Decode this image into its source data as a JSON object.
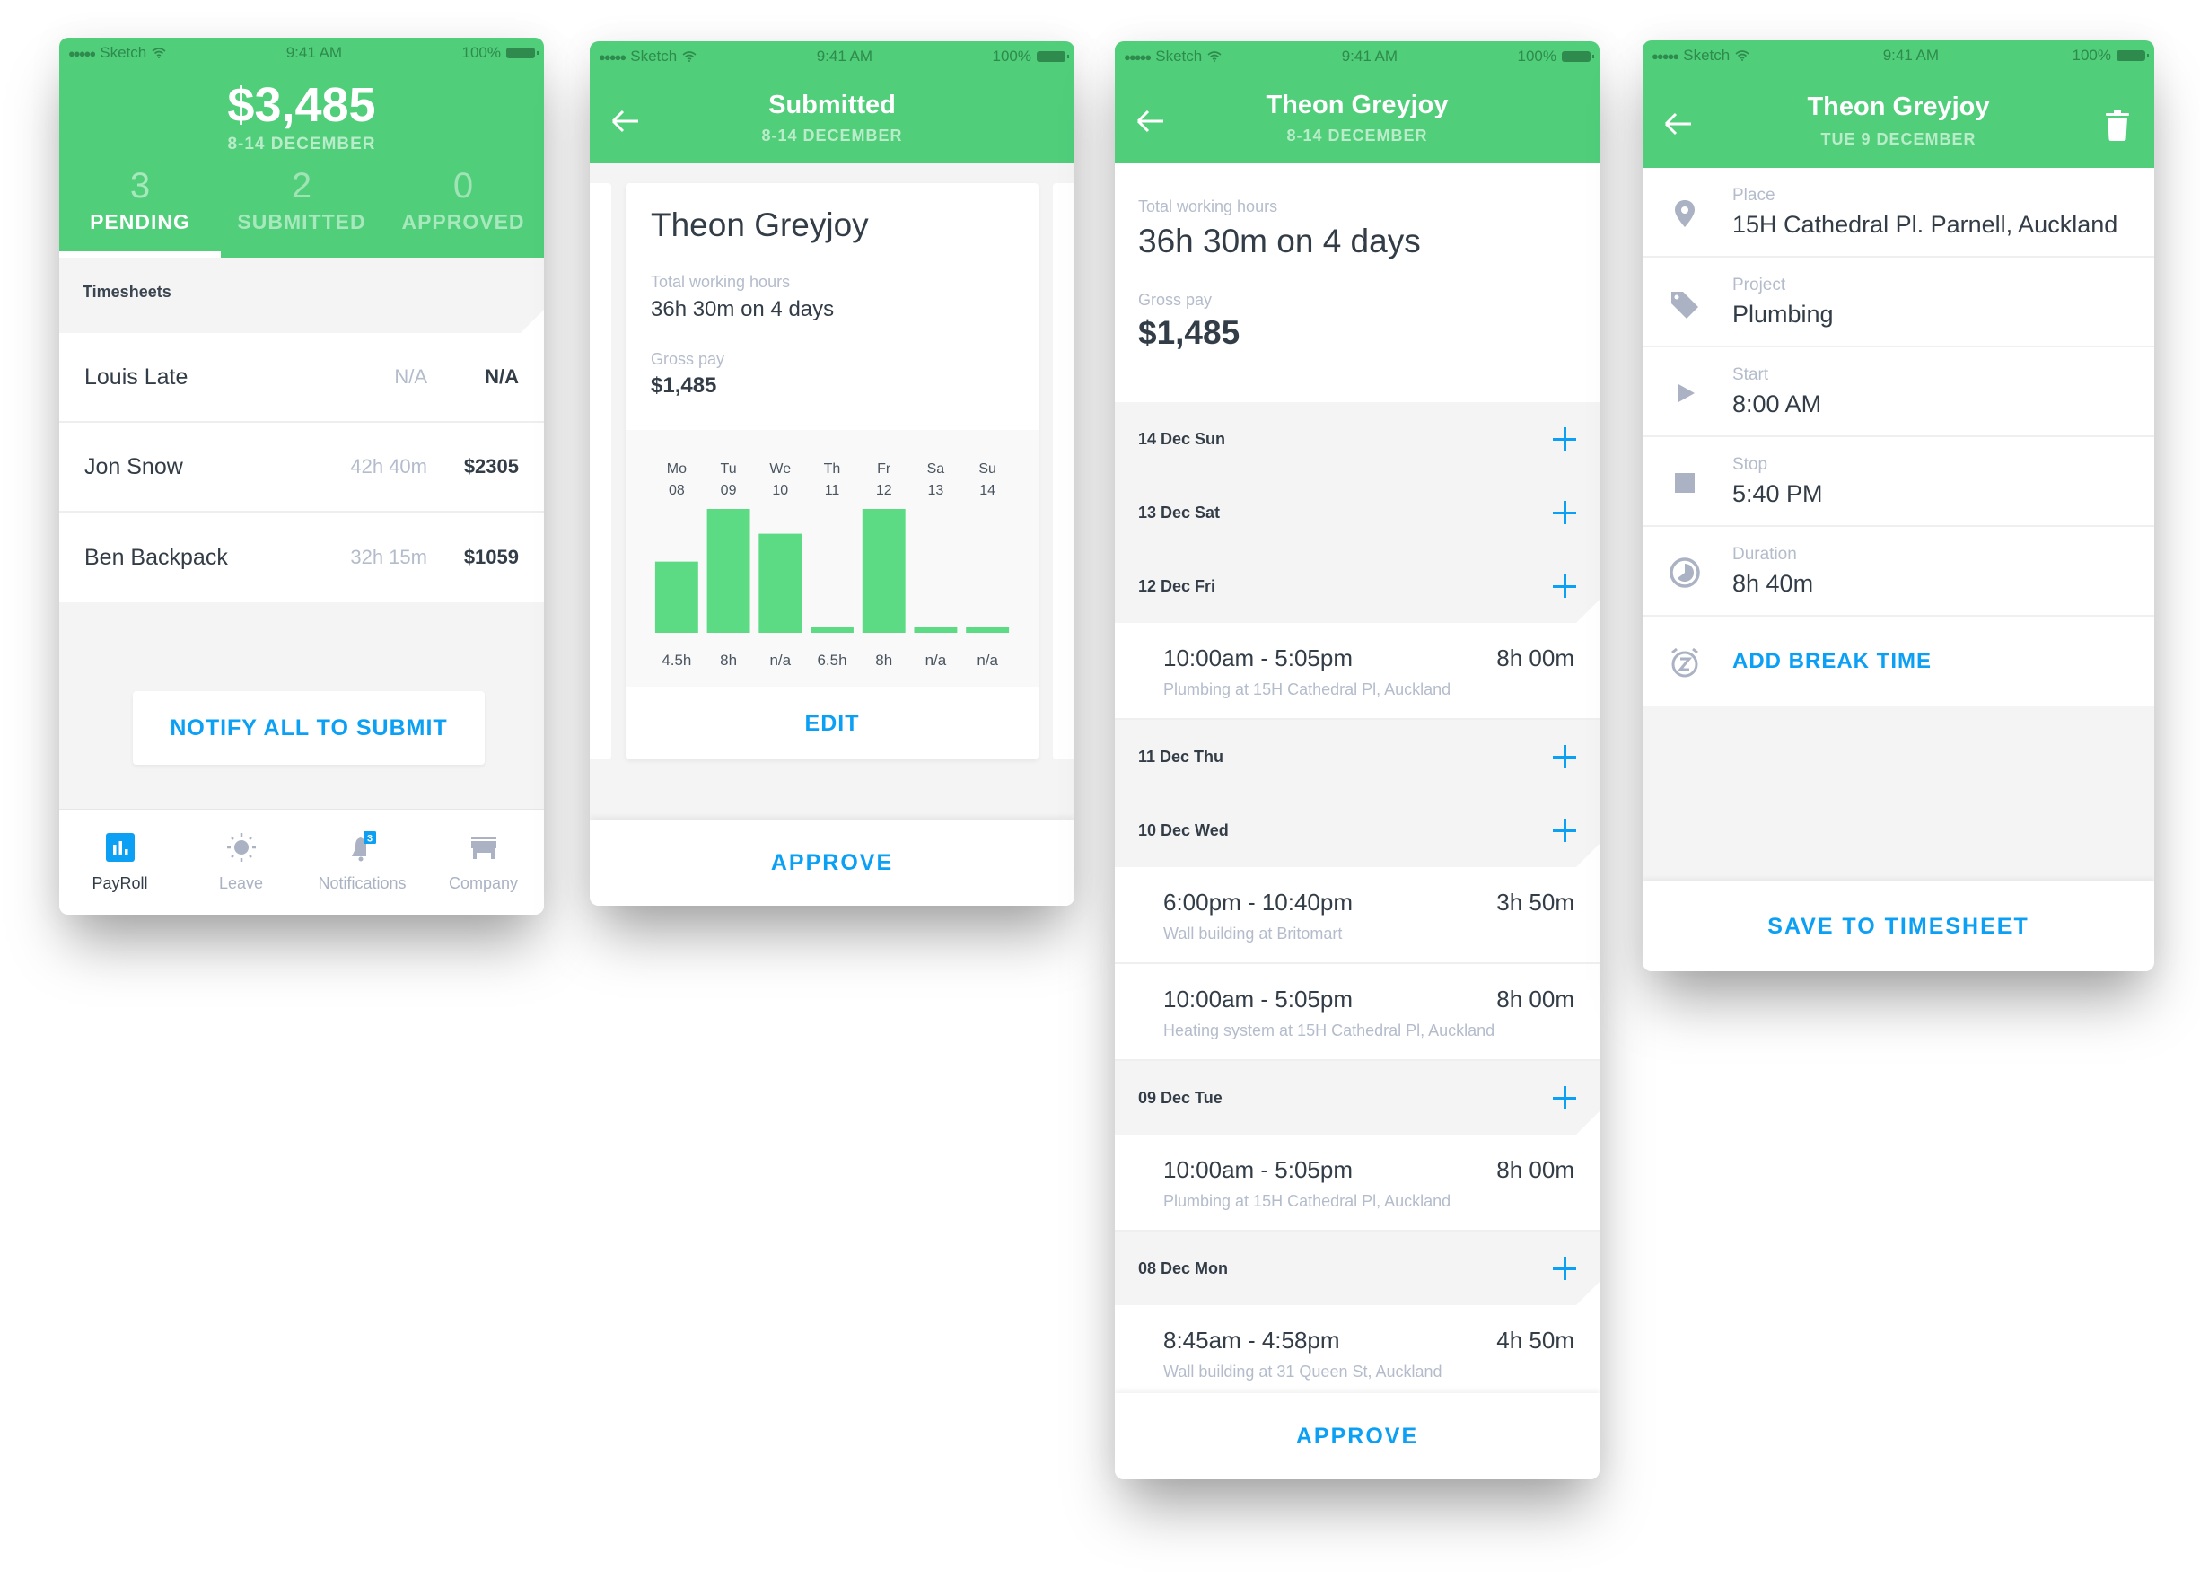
{
  "colors": {
    "brand_green": "#50ce7a",
    "accent_blue": "#0ca0f5",
    "bar_green": "#5cdb84",
    "text_dark": "#333d48",
    "text_muted": "#b4bccc"
  },
  "status_bar": {
    "carrier": "Sketch",
    "time": "9:41 AM",
    "battery": "100%"
  },
  "screen1": {
    "amount": "$3,485",
    "date_range": "8-14 DECEMBER",
    "tabs": [
      {
        "count": "3",
        "label": "PENDING",
        "active": true
      },
      {
        "count": "2",
        "label": "SUBMITTED",
        "active": false
      },
      {
        "count": "0",
        "label": "APPROVED",
        "active": false
      }
    ],
    "section_title": "Timesheets",
    "rows": [
      {
        "name": "Louis Late",
        "hours": "N/A",
        "pay": "N/A"
      },
      {
        "name": "Jon Snow",
        "hours": "42h 40m",
        "pay": "$2305"
      },
      {
        "name": "Ben Backpack",
        "hours": "32h 15m",
        "pay": "$1059"
      }
    ],
    "notify_button": "NOTIFY ALL TO SUBMIT",
    "tabbar": [
      {
        "label": "PayRoll",
        "icon": "payroll-chart-icon",
        "active": true
      },
      {
        "label": "Leave",
        "icon": "sun-icon",
        "active": false
      },
      {
        "label": "Notifications",
        "icon": "bell-icon",
        "active": false,
        "badge": "3"
      },
      {
        "label": "Company",
        "icon": "store-icon",
        "active": false
      }
    ]
  },
  "screen2": {
    "title": "Submitted",
    "subtitle": "8-14 DECEMBER",
    "card": {
      "name": "Theon Greyjoy",
      "total_label": "Total working hours",
      "total_value": "36h 30m on 4 days",
      "gross_label": "Gross pay",
      "gross_value": "$1,485"
    },
    "edit_button": "EDIT",
    "approve_button": "APPROVE"
  },
  "chart_data": {
    "type": "bar",
    "title": "",
    "xlabel": "",
    "ylabel": "",
    "categories": [
      "Mo 08",
      "Tu 09",
      "We 10",
      "Th 11",
      "Fr 12",
      "Sa 13",
      "Su 14"
    ],
    "day_names": [
      "Mo",
      "Tu",
      "We",
      "Th",
      "Fr",
      "Sa",
      "Su"
    ],
    "day_numbers": [
      "08",
      "09",
      "10",
      "11",
      "12",
      "13",
      "14"
    ],
    "value_labels": [
      "4.5h",
      "8h",
      "n/a",
      "6.5h",
      "8h",
      "n/a",
      "n/a"
    ],
    "values": [
      4.6,
      8,
      6.4,
      0.4,
      8,
      0.4,
      0.4
    ],
    "ylim": [
      0,
      8
    ],
    "grid": false,
    "legend": "none"
  },
  "screen3": {
    "title": "Theon Greyjoy",
    "subtitle": "8-14 DECEMBER",
    "total_label": "Total working hours",
    "total_value": "36h 30m on 4 days",
    "gross_label": "Gross pay",
    "gross_value": "$1,485",
    "days": [
      {
        "label": "14 Dec Sun",
        "entries": []
      },
      {
        "label": "13 Dec Sat",
        "entries": []
      },
      {
        "label": "12 Dec Fri",
        "entries": [
          {
            "range": "10:00am - 5:05pm",
            "duration": "8h 00m",
            "desc": "Plumbing at 15H Cathedral Pl, Auckland"
          }
        ]
      },
      {
        "label": "11 Dec Thu",
        "entries": []
      },
      {
        "label": "10 Dec Wed",
        "entries": [
          {
            "range": "6:00pm - 10:40pm",
            "duration": "3h 50m",
            "desc": "Wall building at Britomart"
          },
          {
            "range": "10:00am - 5:05pm",
            "duration": "8h 00m",
            "desc": "Heating system at 15H Cathedral Pl, Auckland"
          }
        ]
      },
      {
        "label": "09 Dec Tue",
        "entries": [
          {
            "range": "10:00am - 5:05pm",
            "duration": "8h 00m",
            "desc": "Plumbing at 15H Cathedral Pl, Auckland"
          }
        ]
      },
      {
        "label": "08 Dec Mon",
        "entries": [
          {
            "range": "8:45am - 4:58pm",
            "duration": "4h 50m",
            "desc": "Wall building at 31 Queen St, Auckland"
          }
        ]
      }
    ],
    "approve_button": "APPROVE"
  },
  "screen4": {
    "title": "Theon Greyjoy",
    "subtitle": "TUE 9 DECEMBER",
    "fields": [
      {
        "icon": "location-pin-icon",
        "label": "Place",
        "value": "15H Cathedral Pl. Parnell, Auckland"
      },
      {
        "icon": "tag-icon",
        "label": "Project",
        "value": "Plumbing"
      },
      {
        "icon": "play-icon",
        "label": "Start",
        "value": "8:00 AM"
      },
      {
        "icon": "stop-icon",
        "label": "Stop",
        "value": "5:40 PM"
      },
      {
        "icon": "clock-icon",
        "label": "Duration",
        "value": "8h 40m"
      }
    ],
    "add_break": "ADD BREAK TIME",
    "save_button": "SAVE TO TIMESHEET"
  }
}
